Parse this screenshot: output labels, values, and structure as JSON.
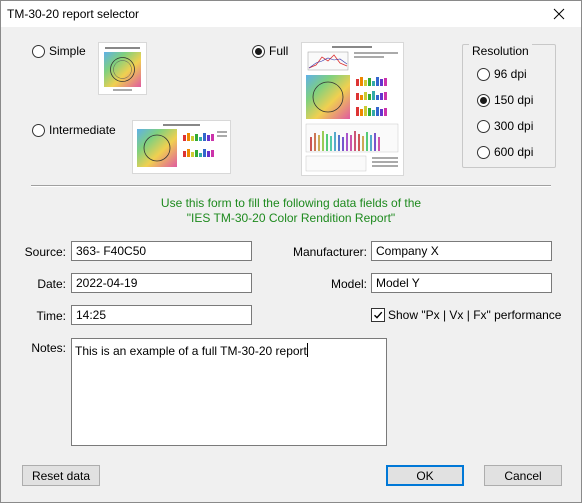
{
  "window": {
    "title": "TM-30-20 report selector"
  },
  "report_types": {
    "simple": "Simple",
    "intermediate": "Intermediate",
    "full": "Full",
    "selected": "Full"
  },
  "resolution": {
    "label": "Resolution",
    "options": [
      "96 dpi",
      "150 dpi",
      "300 dpi",
      "600 dpi"
    ],
    "selected": "150 dpi"
  },
  "info": {
    "line1": "Use this form to fill the following data fields of the",
    "line2": "\"IES TM-30-20 Color Rendition Report\""
  },
  "fields": {
    "source": {
      "label": "Source:",
      "value": "363- F40C50"
    },
    "date": {
      "label": "Date:",
      "value": "2022-04-19"
    },
    "time": {
      "label": "Time:",
      "value": "14:25"
    },
    "manufacturer": {
      "label": "Manufacturer:",
      "value": "Company X"
    },
    "model": {
      "label": "Model:",
      "value": "Model Y"
    },
    "notes": {
      "label": "Notes:",
      "value": "This is an example of a full TM-30-20 report"
    }
  },
  "show_performance": {
    "label": "Show \"Px | Vx | Fx\" performance",
    "checked": true
  },
  "buttons": {
    "reset": "Reset data",
    "ok": "OK",
    "cancel": "Cancel"
  }
}
